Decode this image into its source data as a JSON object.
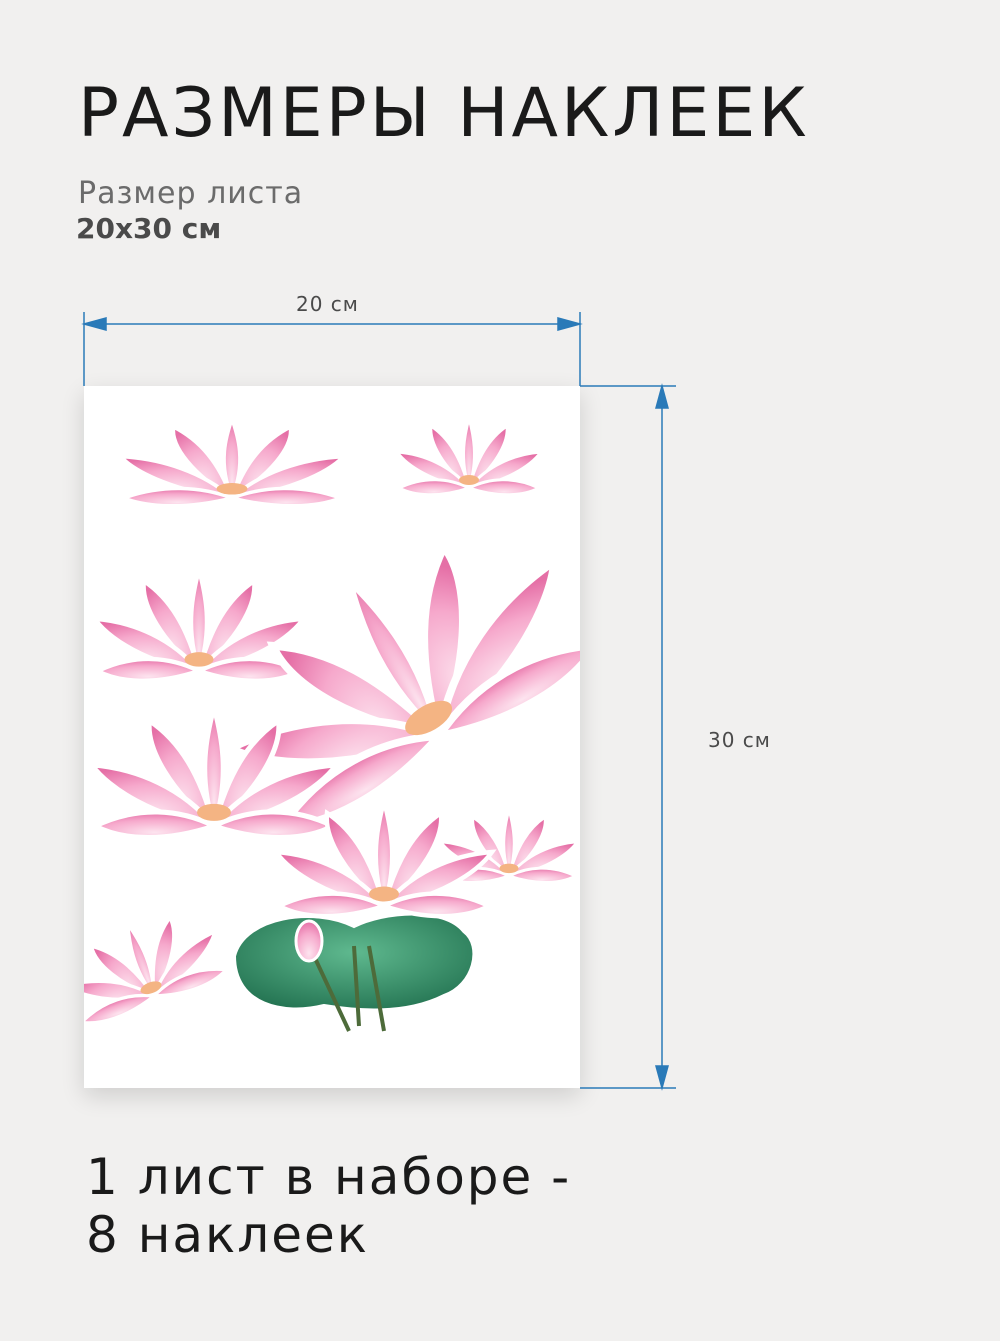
{
  "header": {
    "title": "РАЗМЕРЫ НАКЛЕЕК",
    "sheet_size_label": "Размер листа",
    "sheet_size_value": "20х30 см"
  },
  "dimensions": {
    "width_label": "20 см",
    "height_label": "30 см",
    "arrow_color": "#2a7ab8"
  },
  "sheet": {
    "sticker_count": 8
  },
  "footer": {
    "line1": "1 лист в наборе -",
    "line2": "8 наклеек"
  },
  "colors": {
    "background": "#f1f0ef",
    "petal": "#f6a9cc",
    "petal_dark": "#e56fa6",
    "leaf": "#2e8a64"
  }
}
